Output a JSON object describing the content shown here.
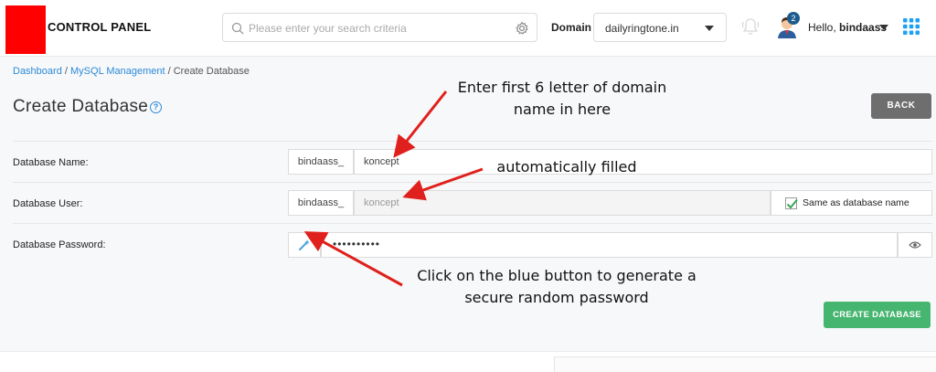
{
  "header": {
    "logo_text": "CONTROL PANEL",
    "search_placeholder": "Please enter your search criteria",
    "domain_label": "Domain",
    "domain_value": "dailyringtone.in",
    "notification_count": "2",
    "greeting": "Hello,",
    "username": "bindaass"
  },
  "breadcrumb": {
    "items": [
      "Dashboard",
      "MySQL Management",
      "Create Database"
    ],
    "separator": "/"
  },
  "page": {
    "title": "Create Database",
    "help_glyph": "?",
    "back_label": "BACK"
  },
  "form": {
    "db_name_label": "Database Name:",
    "db_name_prefix": "bindaass_",
    "db_name_value": "koncept",
    "db_user_label": "Database User:",
    "db_user_prefix": "bindaass_",
    "db_user_value": "koncept",
    "same_as_label": "Same as database name",
    "same_as_checked": true,
    "db_password_label": "Database Password:",
    "db_password_value": "••••••••••",
    "create_label": "CREATE DATABASE"
  },
  "annotations": {
    "note1_line1": "Enter first 6 letter of domain",
    "note1_line2": "name in here",
    "note2": "automatically filled",
    "note3_line1": "Click on the blue button to generate a",
    "note3_line2": "secure random password",
    "arrow_color": "#e0201c"
  },
  "colors": {
    "logo_red": "#ff0000",
    "link_blue": "#2b8ad6",
    "back_gray": "#6e6e6e",
    "create_green": "#46b56f",
    "check_green": "#3aa655"
  }
}
